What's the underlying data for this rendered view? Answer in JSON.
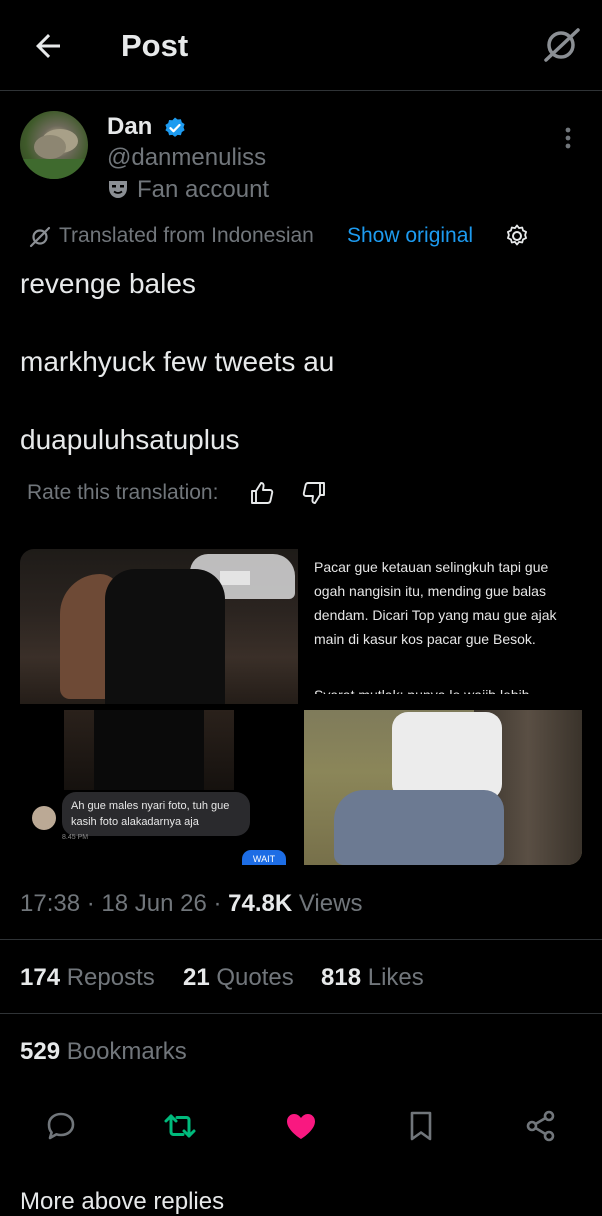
{
  "header": {
    "title": "Post"
  },
  "author": {
    "name": "Dan",
    "handle": "@danmenuliss",
    "label": "Fan account"
  },
  "translation": {
    "text": "Translated from Indonesian",
    "show_original": "Show original",
    "rate_label": "Rate this translation:"
  },
  "post": {
    "lines": [
      "revenge bales",
      "markhyuck few tweets au",
      "duapuluhsatuplus"
    ]
  },
  "media": {
    "text_card": "Pacar gue ketauan selingkuh tapi gue ogah nangisin itu, mending gue balas dendam. Dicari Top yang mau gue ajak main di kasur kos pacar gue Besok.",
    "text_card_more": "Syarat mutlak: punya lo wajib lebih",
    "chat_bubble": "Ah gue males nyari foto, tuh gue kasih foto alakadarnya aja",
    "chat_time": "8.45 PM",
    "wait_button": "WAIT"
  },
  "meta": {
    "time": "17:38",
    "date": "18 Jun 26",
    "views_count": "74.8K",
    "views_label": "Views"
  },
  "stats": {
    "reposts_count": "174",
    "reposts_label": "Reposts",
    "quotes_count": "21",
    "quotes_label": "Quotes",
    "likes_count": "818",
    "likes_label": "Likes",
    "bookmarks_count": "529",
    "bookmarks_label": "Bookmarks"
  },
  "footer_partial": "More above replies",
  "colors": {
    "accent": "#1d9bf0",
    "repost": "#00ba7c",
    "like": "#f91880",
    "muted": "#71767b"
  },
  "icons": [
    "back-arrow-icon",
    "grok-icon",
    "verified-badge-icon",
    "fan-mask-icon",
    "more-vertical-icon",
    "translate-icon",
    "gear-icon",
    "thumbs-up-icon",
    "thumbs-down-icon",
    "reply-icon",
    "repost-icon",
    "like-icon",
    "bookmark-icon",
    "share-icon"
  ]
}
